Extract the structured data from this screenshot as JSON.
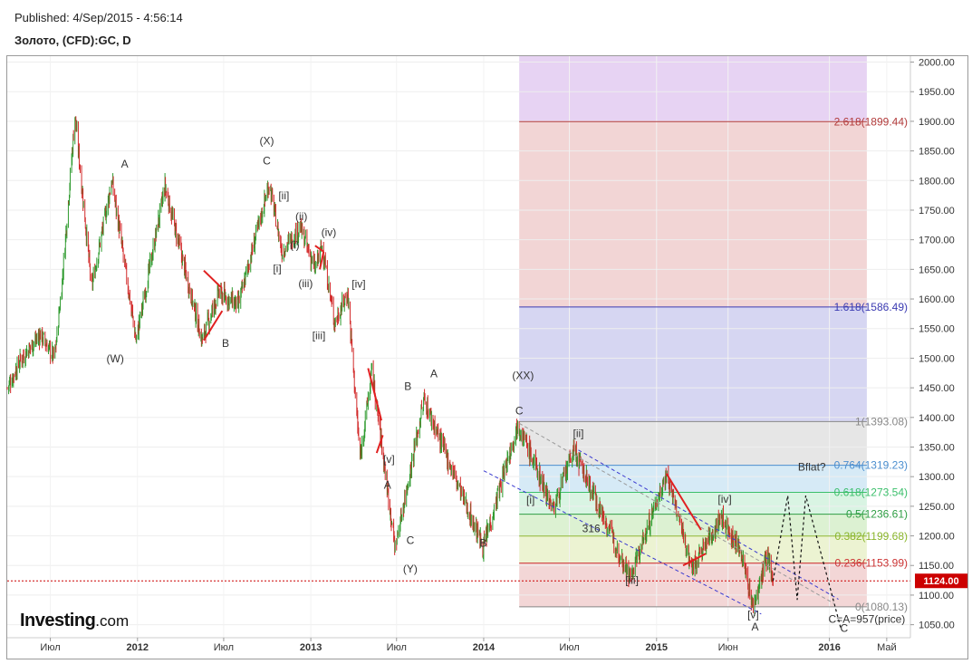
{
  "header": {
    "published": "Published: 4/Sep/2015 - 4:56:14",
    "instrument": "Золото, (CFD):GC, D"
  },
  "branding": {
    "logo_main": "Investing",
    "logo_suffix": ".com"
  },
  "colors": {
    "up_candle": "#2e9a2e",
    "down_candle": "#d22a2a",
    "price_line": "#cc0000",
    "fib_levels": [
      "#b23b3b",
      "#3b3bb2",
      "#888888",
      "#4b8ecf",
      "#3bbf6b",
      "#2f9e44",
      "#8ab52b",
      "#cc3333",
      "#888888"
    ]
  },
  "chart_data": {
    "type": "candlestick",
    "title": "",
    "xlabel": "",
    "ylabel": "",
    "ylim": [
      1028,
      2010
    ],
    "x_tick_labels": [
      "Июл",
      "2012",
      "Июл",
      "2013",
      "Июл",
      "2014",
      "Июл",
      "2015",
      "Июн",
      "2016",
      "Май"
    ],
    "y_ticks": [
      1050,
      1100,
      1150,
      1200,
      1250,
      1300,
      1350,
      1400,
      1450,
      1500,
      1550,
      1600,
      1650,
      1700,
      1750,
      1800,
      1850,
      1900,
      1950,
      2000
    ],
    "y_tick_labels": [
      "1050.00",
      "1100.00",
      "1150.00",
      "1200.00",
      "1250.00",
      "1300.00",
      "1350.00",
      "1400.00",
      "1450.00",
      "1500.00",
      "1550.00",
      "1600.00",
      "1650.00",
      "1700.00",
      "1750.00",
      "1800.00",
      "1850.00",
      "1900.00",
      "1950.00",
      "2000.00"
    ],
    "grid": true,
    "last_price": 1124.0,
    "last_price_label": "1124.00",
    "price_path": [
      {
        "date": "2011-04-01",
        "price": 1450
      },
      {
        "date": "2011-05-01",
        "price": 1500
      },
      {
        "date": "2011-06-10",
        "price": 1540
      },
      {
        "date": "2011-07-10",
        "price": 1500
      },
      {
        "date": "2011-07-25",
        "price": 1620
      },
      {
        "date": "2011-08-22",
        "price": 1910
      },
      {
        "date": "2011-09-26",
        "price": 1620
      },
      {
        "date": "2011-11-08",
        "price": 1800
      },
      {
        "date": "2011-12-29",
        "price": 1530
      },
      {
        "date": "2012-02-28",
        "price": 1790
      },
      {
        "date": "2012-05-16",
        "price": 1530
      },
      {
        "date": "2012-06-20",
        "price": 1610
      },
      {
        "date": "2012-08-01",
        "price": 1590
      },
      {
        "date": "2012-10-05",
        "price": 1795
      },
      {
        "date": "2012-11-01",
        "price": 1680
      },
      {
        "date": "2012-12-10",
        "price": 1720
      },
      {
        "date": "2013-01-10",
        "price": 1650
      },
      {
        "date": "2013-01-25",
        "price": 1690
      },
      {
        "date": "2013-02-20",
        "price": 1560
      },
      {
        "date": "2013-03-20",
        "price": 1610
      },
      {
        "date": "2013-04-15",
        "price": 1330
      },
      {
        "date": "2013-05-10",
        "price": 1480
      },
      {
        "date": "2013-06-28",
        "price": 1180
      },
      {
        "date": "2013-08-28",
        "price": 1430
      },
      {
        "date": "2013-12-31",
        "price": 1180
      },
      {
        "date": "2014-03-14",
        "price": 1390
      },
      {
        "date": "2014-05-28",
        "price": 1245
      },
      {
        "date": "2014-07-10",
        "price": 1345
      },
      {
        "date": "2014-11-07",
        "price": 1130
      },
      {
        "date": "2015-01-22",
        "price": 1305
      },
      {
        "date": "2015-03-17",
        "price": 1145
      },
      {
        "date": "2015-05-18",
        "price": 1232
      },
      {
        "date": "2015-06-30",
        "price": 1168
      },
      {
        "date": "2015-07-24",
        "price": 1077
      },
      {
        "date": "2015-08-24",
        "price": 1168
      },
      {
        "date": "2015-09-04",
        "price": 1124
      }
    ],
    "fibonacci": {
      "start_date": "2014-03-17",
      "end_date": "2016-03-20",
      "levels": [
        {
          "ratio": 2.618,
          "price": 1899.44,
          "label": "2.618(1899.44)"
        },
        {
          "ratio": 1.618,
          "price": 1586.49,
          "label": "1.618(1586.49)"
        },
        {
          "ratio": 1,
          "price": 1393.08,
          "label": "1(1393.08)"
        },
        {
          "ratio": 0.764,
          "price": 1319.23,
          "label": "0.764(1319.23)"
        },
        {
          "ratio": 0.618,
          "price": 1273.54,
          "label": "0.618(1273.54)"
        },
        {
          "ratio": 0.5,
          "price": 1236.61,
          "label": "0.5(1236.61)"
        },
        {
          "ratio": 0.382,
          "price": 1199.68,
          "label": "0.382(1199.68)"
        },
        {
          "ratio": 0.236,
          "price": 1153.99,
          "label": "0.236(1153.99)"
        },
        {
          "ratio": 0,
          "price": 1080.13,
          "label": "0(1080.13)"
        }
      ],
      "zone_colors": [
        "#e7d3f3",
        "#f2d5d5",
        "#d6d6f2",
        "#e6e6e6",
        "#d6eaf6",
        "#d9f4e3",
        "#dcf1d2",
        "#ecf3d2",
        "#f3d6d6"
      ]
    },
    "channel_lines": [
      {
        "style": "dashed-gray",
        "from": {
          "date": "2014-03-17",
          "price": 1390
        },
        "to": {
          "date": "2016-01-10",
          "price": 1086
        }
      },
      {
        "style": "dashed-blue",
        "from": {
          "date": "2014-07-20",
          "price": 1345
        },
        "to": {
          "date": "2016-01-20",
          "price": 1093
        }
      },
      {
        "style": "dashed-blue",
        "from": {
          "date": "2014-01-01",
          "price": 1310
        },
        "to": {
          "date": "2015-08-10",
          "price": 1068
        }
      }
    ],
    "projection": [
      {
        "date": "2015-09-04",
        "price": 1124
      },
      {
        "date": "2015-10-05",
        "price": 1268
      },
      {
        "date": "2015-10-25",
        "price": 1092
      },
      {
        "date": "2015-11-12",
        "price": 1268
      },
      {
        "date": "2016-01-25",
        "price": 1044
      }
    ],
    "triangles": [
      [
        {
          "date": "2012-05-20",
          "price": 1648
        },
        {
          "date": "2012-06-25",
          "price": 1620
        },
        {
          "date": "2012-05-20",
          "price": 1530
        },
        {
          "date": "2012-06-28",
          "price": 1580
        }
      ],
      [
        {
          "date": "2013-05-02",
          "price": 1483
        },
        {
          "date": "2013-05-30",
          "price": 1395
        },
        {
          "date": "2013-05-20",
          "price": 1340
        },
        {
          "date": "2013-06-02",
          "price": 1370
        }
      ],
      [
        {
          "date": "2013-01-10",
          "price": 1690
        },
        {
          "date": "2013-01-28",
          "price": 1680
        },
        {
          "date": "2013-01-20",
          "price": 1650
        }
      ],
      [
        {
          "date": "2015-01-22",
          "price": 1305
        },
        {
          "date": "2015-04-05",
          "price": 1210
        },
        {
          "date": "2015-02-26",
          "price": 1150
        },
        {
          "date": "2015-04-15",
          "price": 1170
        }
      ]
    ],
    "annotations": [
      {
        "text": "(W)",
        "date": "2011-11-15",
        "price": 1493
      },
      {
        "text": "A",
        "date": "2011-12-05",
        "price": 1822
      },
      {
        "text": "B",
        "date": "2012-07-05",
        "price": 1519
      },
      {
        "text": "(X)",
        "date": "2012-09-30",
        "price": 1861
      },
      {
        "text": "C",
        "date": "2012-09-30",
        "price": 1827
      },
      {
        "text": "[ii]",
        "date": "2012-11-05",
        "price": 1768
      },
      {
        "text": "[i]",
        "date": "2012-10-22",
        "price": 1645
      },
      {
        "text": "(ii)",
        "date": "2012-12-12",
        "price": 1733
      },
      {
        "text": "(i)",
        "date": "2012-11-28",
        "price": 1685
      },
      {
        "text": "(iii)",
        "date": "2012-12-21",
        "price": 1620
      },
      {
        "text": "(iv)",
        "date": "2013-02-08",
        "price": 1706
      },
      {
        "text": "[iv]",
        "date": "2013-04-12",
        "price": 1619
      },
      {
        "text": "[iii]",
        "date": "2013-01-18",
        "price": 1532
      },
      {
        "text": "B",
        "date": "2013-07-25",
        "price": 1446
      },
      {
        "text": "[v]",
        "date": "2013-06-15",
        "price": 1323
      },
      {
        "text": "A",
        "date": "2013-06-12",
        "price": 1280
      },
      {
        "text": "C",
        "date": "2013-07-30",
        "price": 1186
      },
      {
        "text": "(Y)",
        "date": "2013-07-30",
        "price": 1138
      },
      {
        "text": "A",
        "date": "2013-09-18",
        "price": 1468
      },
      {
        "text": "B",
        "date": "2013-12-31",
        "price": 1182
      },
      {
        "text": "(XX)",
        "date": "2014-03-25",
        "price": 1465
      },
      {
        "text": "C",
        "date": "2014-03-17",
        "price": 1405
      },
      {
        "text": "[ii]",
        "date": "2014-07-20",
        "price": 1367
      },
      {
        "text": "[i]",
        "date": "2014-04-10",
        "price": 1254
      },
      {
        "text": "316",
        "date": "2014-08-16",
        "price": 1206
      },
      {
        "text": "[iii]",
        "date": "2014-11-10",
        "price": 1119
      },
      {
        "text": "[iv]",
        "date": "2015-05-25",
        "price": 1256
      },
      {
        "text": "[v]",
        "date": "2015-07-24",
        "price": 1061
      },
      {
        "text": "A",
        "date": "2015-07-28",
        "price": 1040
      },
      {
        "text": "Bflat?",
        "date": "2015-11-25",
        "price": 1310
      },
      {
        "text": "C",
        "date": "2016-02-01",
        "price": 1038
      },
      {
        "text": "C=A=957(price)",
        "date": "2016-03-20",
        "price": 1053
      }
    ]
  }
}
